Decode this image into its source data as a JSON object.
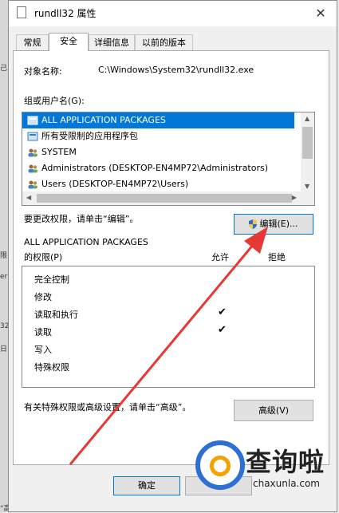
{
  "window": {
    "title": "rundll32 属性",
    "close_glyph": "✕"
  },
  "tabs": [
    {
      "label": "常规",
      "active": false
    },
    {
      "label": "安全",
      "active": true
    },
    {
      "label": "详细信息",
      "active": false
    },
    {
      "label": "以前的版本",
      "active": false
    }
  ],
  "object": {
    "label": "对象名称:",
    "value": "C:\\Windows\\System32\\rundll32.exe"
  },
  "groups": {
    "label": "组或用户名(G):",
    "items": [
      {
        "label": "ALL APPLICATION PACKAGES",
        "icon": "package-icon",
        "selected": true
      },
      {
        "label": "所有受限制的应用程序包",
        "icon": "package-icon",
        "selected": false
      },
      {
        "label": "SYSTEM",
        "icon": "users-icon",
        "selected": false
      },
      {
        "label": "Administrators (DESKTOP-EN4MP72\\Administrators)",
        "icon": "users-icon",
        "selected": false
      },
      {
        "label": "Users (DESKTOP-EN4MP72\\Users)",
        "icon": "users-icon",
        "selected": false
      }
    ]
  },
  "change_hint": "要更改权限，请单击“编辑”。",
  "edit_button": "编辑(E)...",
  "permissions": {
    "title_line1": "ALL APPLICATION PACKAGES",
    "title_line2": "的权限(P)",
    "allow_header": "允许",
    "deny_header": "拒绝",
    "rows": [
      {
        "label": "完全控制",
        "allow": false
      },
      {
        "label": "修改",
        "allow": false
      },
      {
        "label": "读取和执行",
        "allow": true
      },
      {
        "label": "读取",
        "allow": true
      },
      {
        "label": "写入",
        "allow": false
      },
      {
        "label": "特殊权限",
        "allow": false
      }
    ],
    "check_glyph": "✔"
  },
  "advanced_hint": "有关特殊权限或高级设置，请单击“高级”。",
  "advanced_button": "高级(V)",
  "ok_button": "确定",
  "left_fragments": [
    "己",
    "限",
    "er",
    "32",
    "日",
    "“高"
  ],
  "watermark": {
    "text": "查询啦",
    "sub": "chaxunla.com"
  },
  "colors": {
    "selection": "#0078d7",
    "annotation_arrow": "#e53935",
    "watermark_blue": "#2d6fd2",
    "watermark_orange": "#f5a100"
  }
}
